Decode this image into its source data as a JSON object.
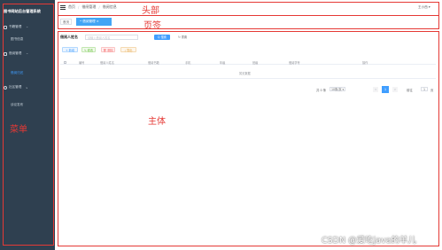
{
  "sidebar": {
    "title": "图书网站后台管理系统",
    "items": [
      {
        "label": "书籍管理",
        "caret": "^"
      },
      {
        "label": "图书信息"
      },
      {
        "label": "借阅管理",
        "caret": "^"
      },
      {
        "label": "借阅归还"
      },
      {
        "label": "社区管理",
        "caret": "v"
      },
      {
        "label": "谈论发布"
      }
    ]
  },
  "header": {
    "breadcrumb": [
      "首页",
      "借阅管理",
      "借阅信息"
    ],
    "separator": "/",
    "user": "王小西 ▾"
  },
  "tabs": {
    "home": "首页",
    "active": "• 借阅管理 ×"
  },
  "search": {
    "label": "借阅人姓名",
    "placeholder": "请输入借阅人姓名",
    "search_btn": "Q 搜索",
    "reset_btn": "↻ 重置"
  },
  "toolbar": {
    "add": "+ 新增",
    "edit": "✎ 修改",
    "delete": "🗑 删除",
    "export": "⤓ 导出"
  },
  "table": {
    "columns": [
      "编号",
      "借阅人姓名",
      "借阅书籍",
      "手机",
      "年级",
      "班级",
      "借阅学号",
      "操作"
    ],
    "empty_text": "暂无数据"
  },
  "pagination": {
    "total": "共 0 条",
    "page_size": "10条/页 ▾",
    "prev": "<",
    "current": "1",
    "next": ">",
    "goto_label": "前往",
    "goto_value": "1",
    "page_suffix": "页"
  },
  "annotations": {
    "menu": "菜单",
    "header": "头部",
    "tabs": "页签",
    "main": "主体"
  },
  "watermark": "CSDN @爱吃java的羊儿"
}
